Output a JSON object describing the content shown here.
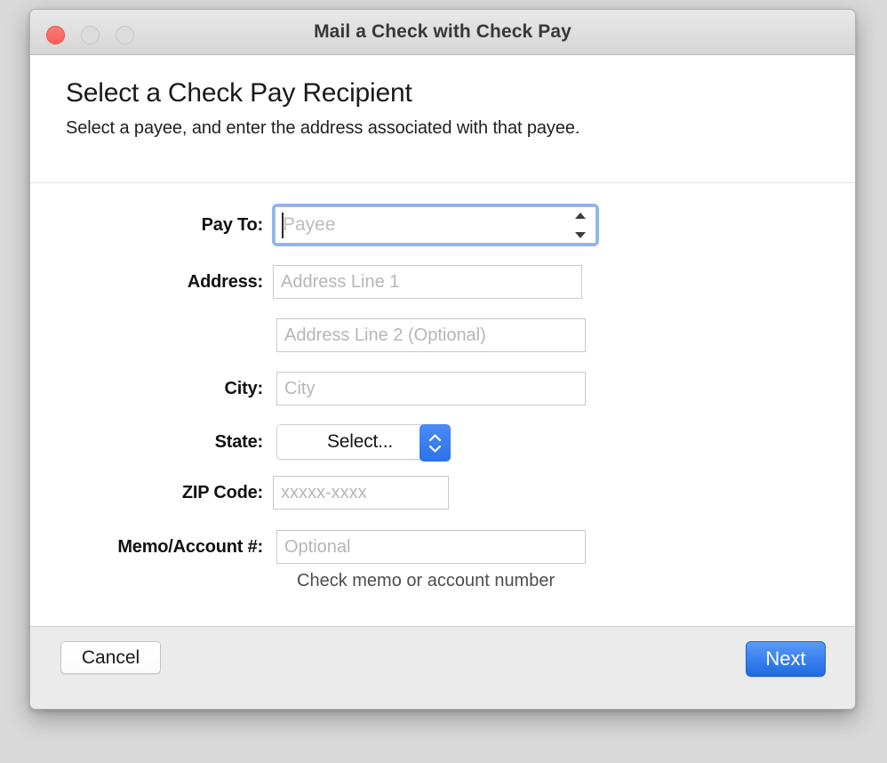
{
  "window": {
    "title": "Mail a Check with Check Pay",
    "controls": {
      "close": "close-button",
      "minimize": "minimize-button",
      "maximize": "maximize-button"
    }
  },
  "header": {
    "title": "Select a Check Pay Recipient",
    "subtitle": "Select a payee, and enter the address associated with that payee."
  },
  "form": {
    "pay_to": {
      "label": "Pay To:",
      "value": "",
      "placeholder": "Payee"
    },
    "address": {
      "label": "Address:",
      "line1": {
        "value": "",
        "placeholder": "Address Line 1"
      },
      "line2": {
        "value": "",
        "placeholder": "Address Line 2 (Optional)"
      }
    },
    "city": {
      "label": "City:",
      "value": "",
      "placeholder": "City"
    },
    "state": {
      "label": "State:",
      "selected": "Select..."
    },
    "zip": {
      "label": "ZIP Code:",
      "value": "",
      "placeholder": "xxxxx-xxxx"
    },
    "memo": {
      "label": "Memo/Account #:",
      "value": "",
      "placeholder": "Optional",
      "help": "Check memo or account number"
    }
  },
  "footer": {
    "cancel_label": "Cancel",
    "next_label": "Next"
  },
  "colors": {
    "accent_blue": "#3b82ef",
    "focus_ring": "#8cb6ef",
    "close_red": "#f96158",
    "window_chrome": "#dedede",
    "footer_bg": "#ebebeb"
  }
}
